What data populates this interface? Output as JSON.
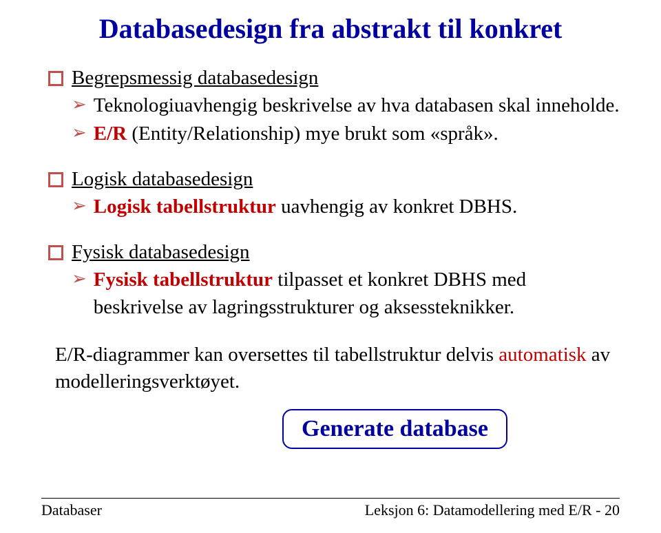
{
  "title": "Databasedesign fra abstrakt til konkret",
  "sections": [
    {
      "heading": "Begrepsmessig databasedesign",
      "items": [
        {
          "plain_before": "Teknologiuavhengig beskrivelse av hva databasen skal inneholde."
        },
        {
          "red_bold": "E/R",
          "plain_after": " (Entity/Relationship) mye brukt som «språk»."
        }
      ]
    },
    {
      "heading": "Logisk databasedesign",
      "items": [
        {
          "red_bold": "Logisk tabellstruktur",
          "plain_after": " uavhengig av konkret DBHS."
        }
      ]
    },
    {
      "heading": "Fysisk databasedesign",
      "items": [
        {
          "red_bold": "Fysisk tabellstruktur",
          "plain_after": " tilpasset et konkret DBHS med beskrivelse av lagringsstrukturer og aksessteknikker."
        }
      ]
    }
  ],
  "bottom_paragraph": {
    "before": "E/R-diagrammer kan oversettes til tabellstruktur delvis ",
    "highlight": "automatisk",
    "after": " av modelleringsverktøyet."
  },
  "generate_label": "Generate database",
  "footer": {
    "left": "Databaser",
    "right": "Leksjon 6: Datamodellering med E/R - 20"
  }
}
